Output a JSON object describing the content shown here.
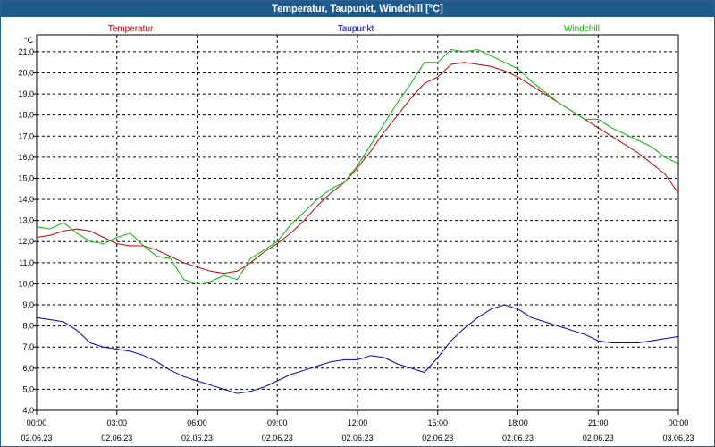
{
  "window": {
    "title": "Temperatur, Taupunkt, Windchill [°C]"
  },
  "chart_data": {
    "type": "line",
    "title": "Temperatur, Taupunkt, Windchill [°C]",
    "ylabel": "°C",
    "xlabel": "",
    "ylim": [
      4.0,
      21.8
    ],
    "yticks": [
      "4,0",
      "5,0",
      "6,0",
      "7,0",
      "8,0",
      "9,0",
      "10,0",
      "11,0",
      "12,0",
      "13,0",
      "14,0",
      "15,0",
      "16,0",
      "17,0",
      "18,0",
      "19,0",
      "20,0",
      "21,0"
    ],
    "xlim_hours": [
      0,
      24
    ],
    "xticks": [
      {
        "time": "00:00",
        "date": "02.06.23"
      },
      {
        "time": "03:00",
        "date": "02.06.23"
      },
      {
        "time": "06:00",
        "date": "02.06.23"
      },
      {
        "time": "09:00",
        "date": "02.06.23"
      },
      {
        "time": "12:00",
        "date": "02.06.23"
      },
      {
        "time": "15:00",
        "date": "02.06.23"
      },
      {
        "time": "18:00",
        "date": "02.06.23"
      },
      {
        "time": "21:00",
        "date": "02.06.23"
      },
      {
        "time": "00:00",
        "date": "03.06.23"
      }
    ],
    "grid": true,
    "legend_position": "top",
    "series": [
      {
        "name": "Temperatur",
        "color": "#cc0000",
        "x": [
          0,
          0.5,
          1,
          1.5,
          2,
          2.5,
          3,
          3.5,
          4,
          4.5,
          5,
          5.5,
          6,
          6.5,
          7,
          7.5,
          8,
          8.5,
          9,
          9.5,
          10,
          10.5,
          11,
          11.5,
          12,
          12.5,
          13,
          13.5,
          14,
          14.5,
          15,
          15.5,
          16,
          16.5,
          17,
          17.5,
          18,
          18.5,
          19,
          19.5,
          20,
          20.5,
          21,
          21.5,
          22,
          22.5,
          23,
          23.5,
          24
        ],
        "values": [
          12.2,
          12.3,
          12.5,
          12.6,
          12.5,
          12.2,
          11.9,
          11.8,
          11.8,
          11.6,
          11.3,
          11.0,
          10.8,
          10.6,
          10.5,
          10.6,
          11.0,
          11.5,
          11.9,
          12.4,
          13.0,
          13.7,
          14.3,
          14.8,
          15.5,
          16.3,
          17.2,
          18.0,
          18.8,
          19.5,
          19.8,
          20.4,
          20.5,
          20.4,
          20.3,
          20.1,
          19.8,
          19.4,
          19.0,
          18.6,
          18.2,
          17.8,
          17.4,
          17.0,
          16.6,
          16.2,
          15.7,
          15.2,
          14.3
        ]
      },
      {
        "name": "Taupunkt",
        "color": "#0000cc",
        "x": [
          0,
          0.5,
          1,
          1.5,
          2,
          2.5,
          3,
          3.5,
          4,
          4.5,
          5,
          5.5,
          6,
          6.5,
          7,
          7.5,
          8,
          8.5,
          9,
          9.5,
          10,
          10.5,
          11,
          11.5,
          12,
          12.5,
          13,
          13.5,
          14,
          14.5,
          15,
          15.5,
          16,
          16.5,
          17,
          17.5,
          18,
          18.5,
          19,
          19.5,
          20,
          20.5,
          21,
          21.5,
          22,
          22.5,
          23,
          23.5,
          24
        ],
        "values": [
          8.4,
          8.3,
          8.2,
          7.8,
          7.2,
          7.0,
          6.9,
          6.8,
          6.6,
          6.3,
          5.9,
          5.6,
          5.4,
          5.2,
          5.0,
          4.8,
          4.9,
          5.1,
          5.4,
          5.7,
          5.9,
          6.1,
          6.3,
          6.4,
          6.4,
          6.6,
          6.5,
          6.2,
          6.0,
          5.8,
          6.5,
          7.3,
          7.9,
          8.4,
          8.8,
          9.0,
          8.8,
          8.4,
          8.2,
          8.0,
          7.8,
          7.6,
          7.3,
          7.2,
          7.2,
          7.2,
          7.3,
          7.4,
          7.5
        ]
      },
      {
        "name": "Windchill",
        "color": "#00bb00",
        "x": [
          0,
          0.5,
          1,
          1.5,
          2,
          2.5,
          3,
          3.5,
          4,
          4.5,
          5,
          5.5,
          6,
          6.5,
          7,
          7.5,
          8,
          8.5,
          9,
          9.5,
          10,
          10.5,
          11,
          11.5,
          12,
          12.5,
          13,
          13.5,
          14,
          14.5,
          15,
          15.5,
          16,
          16.5,
          17,
          17.5,
          18,
          18.5,
          19,
          19.5,
          20,
          20.5,
          21,
          21.5,
          22,
          22.5,
          23,
          23.5,
          24
        ],
        "values": [
          12.7,
          12.6,
          12.9,
          12.4,
          12.0,
          11.9,
          12.2,
          12.4,
          11.8,
          11.3,
          11.2,
          10.2,
          10.0,
          10.1,
          10.4,
          10.2,
          11.2,
          11.6,
          12.0,
          12.8,
          13.4,
          14.0,
          14.5,
          14.8,
          15.6,
          16.6,
          17.6,
          18.6,
          19.5,
          20.5,
          20.5,
          21.1,
          21.0,
          21.1,
          20.8,
          20.5,
          20.2,
          19.6,
          19.1,
          18.6,
          18.2,
          17.8,
          17.8,
          17.4,
          17.1,
          16.8,
          16.5,
          16.0,
          15.7
        ]
      }
    ]
  }
}
